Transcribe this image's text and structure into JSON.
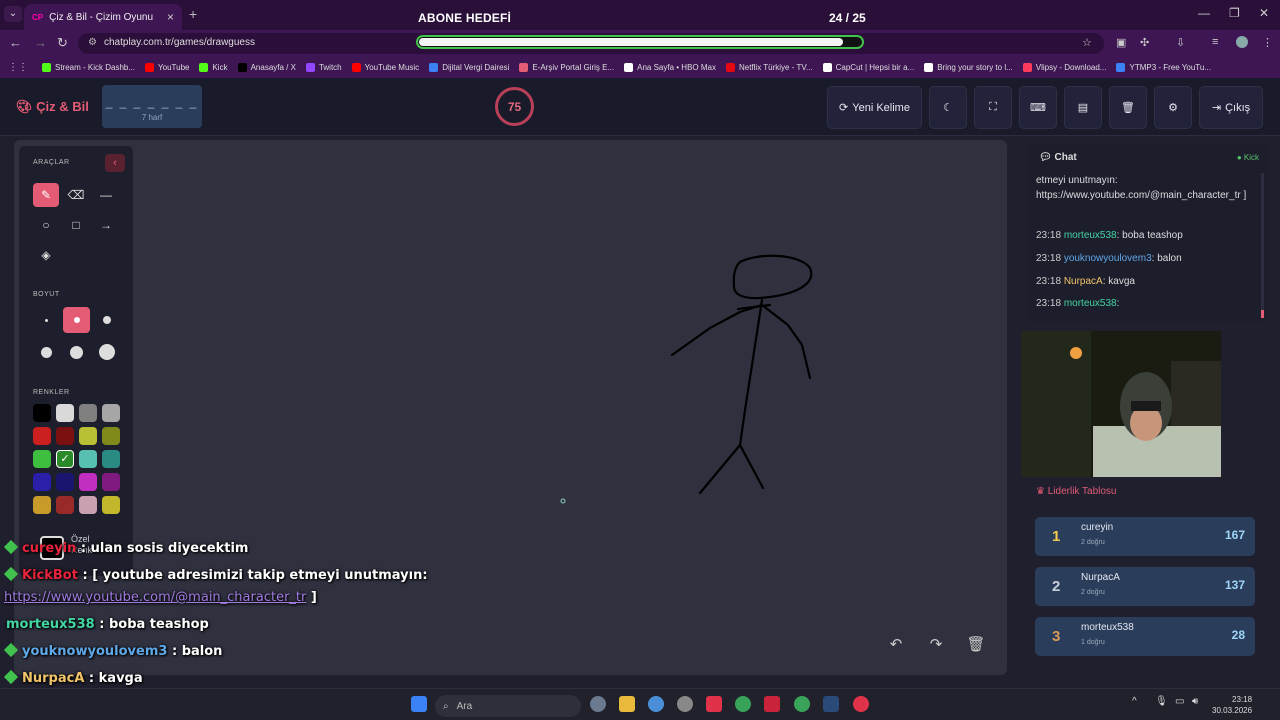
{
  "browser": {
    "tab_title": "Çiz & Bil - Çizim Oyunu",
    "tab_favicon": "CP",
    "url": "chatplay.com.tr/games/drawguess",
    "bookmarks": [
      {
        "label": "Stream - Kick Dashb...",
        "color": "#53fc18"
      },
      {
        "label": "YouTube",
        "color": "#ff0000"
      },
      {
        "label": "Kick",
        "color": "#53fc18"
      },
      {
        "label": "Anasayfa / X",
        "color": "#000000"
      },
      {
        "label": "Twitch",
        "color": "#9146ff"
      },
      {
        "label": "YouTube Music",
        "color": "#ff0000"
      },
      {
        "label": "Dijital Vergi Dairesi",
        "color": "#3b82f6"
      },
      {
        "label": "E-Arşiv Portal Giriş E...",
        "color": "#e35b74"
      },
      {
        "label": "Ana Sayfa • HBO Max",
        "color": "#ffffff"
      },
      {
        "label": "Netflix Türkiye - TV...",
        "color": "#e50914"
      },
      {
        "label": "CapCut | Hepsi bir a...",
        "color": "#ffffff"
      },
      {
        "label": "Bring your story to l...",
        "color": "#ffffff"
      },
      {
        "label": "Vlipsy - Download...",
        "color": "#ff3b5c"
      },
      {
        "label": "YTMP3 - Free YouTu...",
        "color": "#3b82f6"
      }
    ]
  },
  "stream_overlay": {
    "goal_label": "ABONE HEDEFİ",
    "goal_count": "24 / 25",
    "goal_progress": 0.96
  },
  "game": {
    "logo": "Çiz & Bil",
    "word_dashes": "_ _ _ _ _ _ _",
    "word_hint": "7 harf",
    "timer": "75",
    "buttons": {
      "new_word": "Yeni Kelime",
      "exit": "Çıkış"
    },
    "tools_title": "ARAÇLAR",
    "size_title": "BOYUT",
    "colors_title": "RENKLER",
    "custom_color": "Özel Renk",
    "palette": [
      "#000000",
      "#d9d9d9",
      "#808080",
      "#a6a6a6",
      "#cc1f1f",
      "#7a1010",
      "#b8c034",
      "#7f8a1a",
      "#3fbf3f",
      "#2a8a2a",
      "#58c0b0",
      "#2a8a84",
      "#2a1fa8",
      "#1a1670",
      "#c02fc0",
      "#801a80",
      "#c89a2a",
      "#9a2a2a",
      "#c8a0b0",
      "#c0b82a"
    ]
  },
  "overlay_chat": [
    {
      "user": "cureyin",
      "color": "#e8233c",
      "text": ": ulan sosis diyecektim"
    },
    {
      "user": "KickBot",
      "color": "#e8233c",
      "text": ": [ youtube adresimizi takip etmeyi unutmayın:"
    },
    {
      "user": "",
      "color": "#9f7ae0",
      "text": "https://www.youtube.com/@main_character_tr",
      "suffix": " ]"
    },
    {
      "user": "morteux538",
      "color": "#42d6a4",
      "text": ": boba teashop"
    },
    {
      "user": "youknowyoulovem3",
      "color": "#5fa8e8",
      "text": ": balon"
    },
    {
      "user": "NurpacA",
      "color": "#f2c46a",
      "text": ": kavga"
    },
    {
      "user": "morteux538",
      "color": "#42d6a4",
      "text": ":"
    }
  ],
  "chat": {
    "title": "Chat",
    "platform": "Kick",
    "first_message": "etmeyi unutmayın: https://www.youtube.com/@main_character_tr ]",
    "messages": [
      {
        "time": "23:18",
        "user": "morteux538",
        "color": "#42d6a4",
        "text": ": boba teashop"
      },
      {
        "time": "23:18",
        "user": "youknowyoulovem3",
        "color": "#5fa8e8",
        "text": ": balon"
      },
      {
        "time": "23:18",
        "user": "NurpacA",
        "color": "#f2c46a",
        "text": ": kavga"
      },
      {
        "time": "23:18",
        "user": "morteux538",
        "color": "#42d6a4",
        "text": ":"
      }
    ]
  },
  "leaderboard": {
    "title": "Liderlik Tablosu",
    "rows": [
      {
        "rank": "1",
        "name": "cureyin",
        "sub": "2 doğru",
        "points": "167",
        "rank_color": "#f2c94c"
      },
      {
        "rank": "2",
        "name": "NurpacA",
        "sub": "2 doğru",
        "points": "137",
        "rank_color": "#c8d0dc"
      },
      {
        "rank": "3",
        "name": "morteux538",
        "sub": "1 doğru",
        "points": "28",
        "rank_color": "#d89a5a"
      }
    ]
  },
  "taskbar": {
    "search_placeholder": "Ara",
    "time": "23:18",
    "date": "30.03.2026"
  }
}
